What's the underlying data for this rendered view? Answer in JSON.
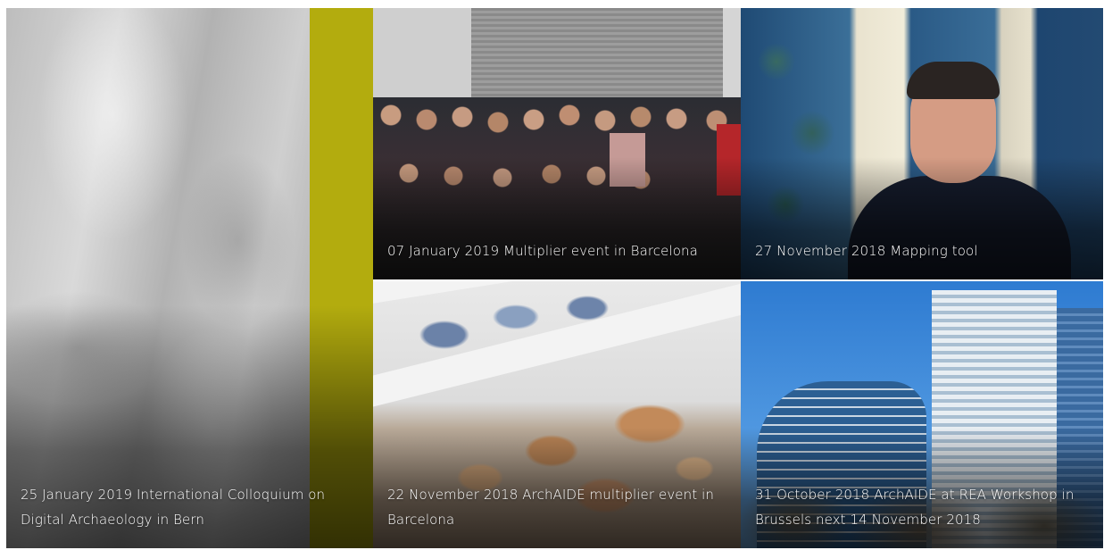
{
  "news_tiles": [
    {
      "caption": "25 January 2019 International Colloquium on Digital Archaeology in Bern"
    },
    {
      "caption": "07 January 2019 Multiplier event in Barcelona"
    },
    {
      "caption": "27 November 2018 Mapping tool"
    },
    {
      "caption": "22 November 2018 ArchAIDE multiplier event in Barcelona"
    },
    {
      "caption": "31 October 2018 ArchAIDE at REA Workshop in Brussels next 14 November 2018"
    }
  ],
  "colors": {
    "accent_strip": "#b3ac0e",
    "caption_text": "#ffffff"
  }
}
